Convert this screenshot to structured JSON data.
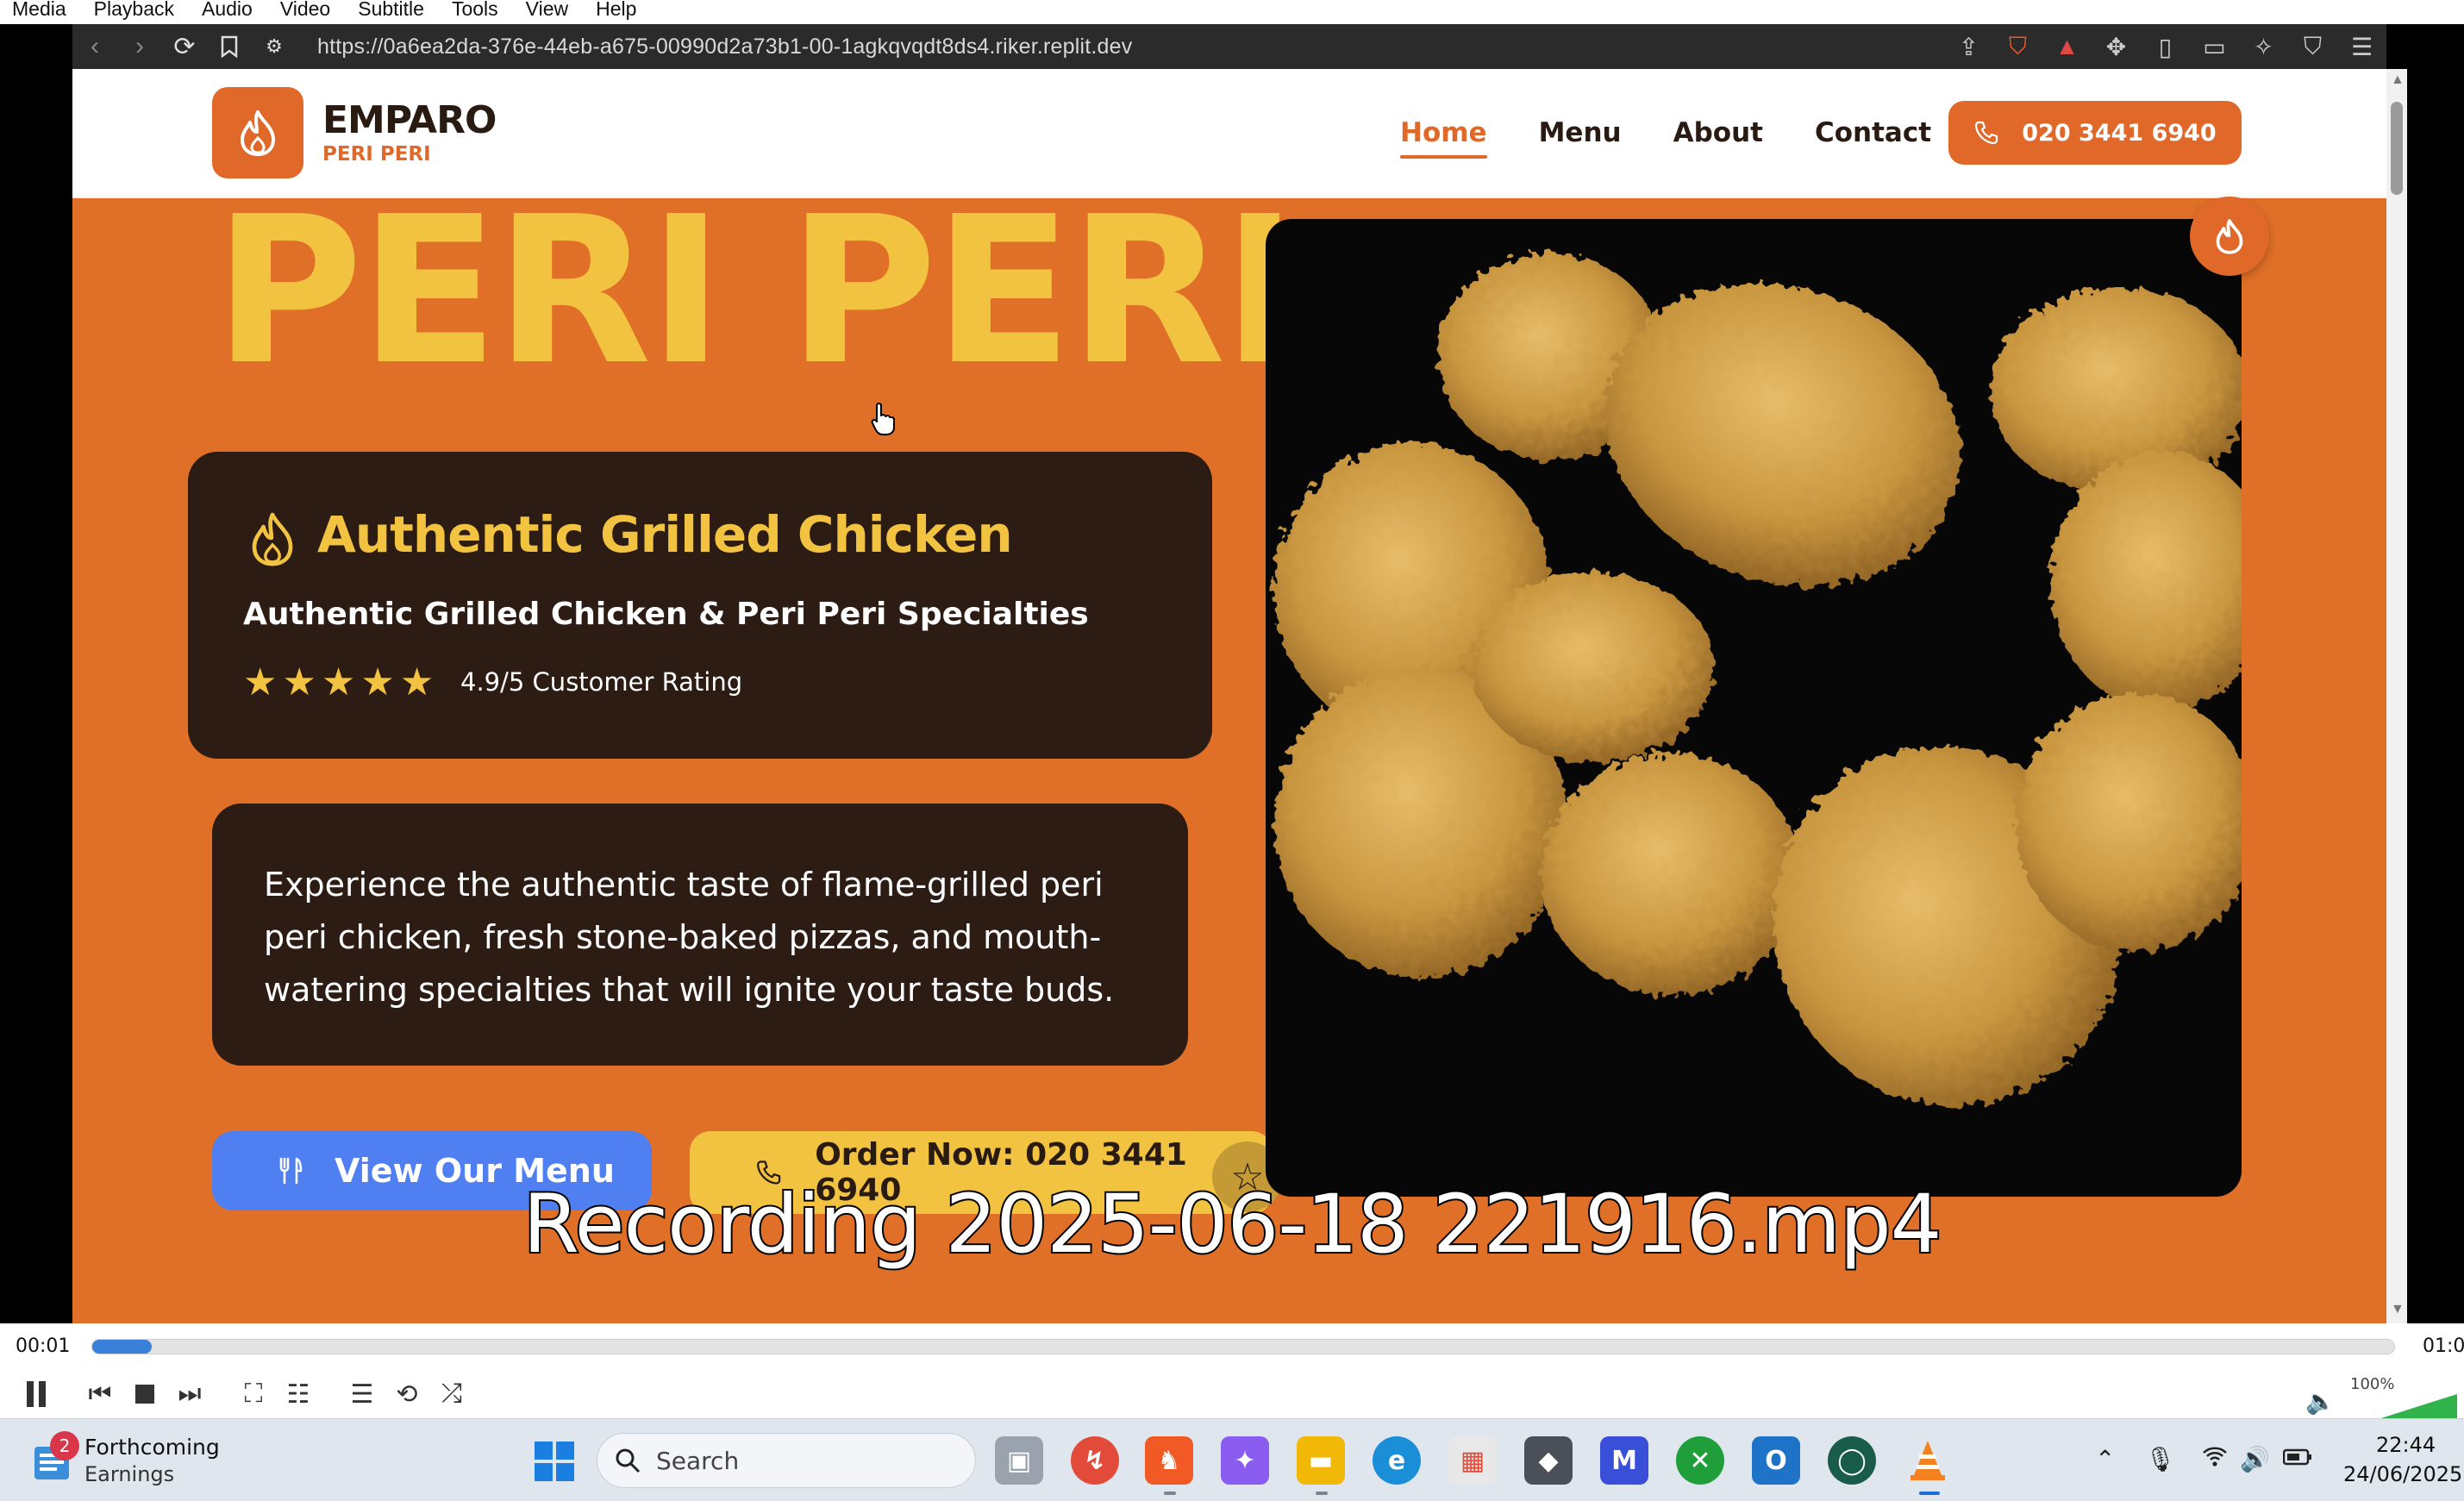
{
  "vlc": {
    "menu": [
      "Media",
      "Playback",
      "Audio",
      "Video",
      "Subtitle",
      "Tools",
      "View",
      "Help"
    ],
    "subtitle_text": "Recording 2025-06-18 221916.mp4",
    "time_current": "00:01",
    "time_total": "01:0",
    "seek_progress_percent": 2.6,
    "volume_label": "100%"
  },
  "browser": {
    "url": "https://0a6ea2da-376e-44eb-a675-00990d2a73b1-00-1agkqvqdt8ds4.riker.replit.dev"
  },
  "site": {
    "logo_name": "EMPARO",
    "logo_sub": "PERI PERI",
    "nav": {
      "home": "Home",
      "menu": "Menu",
      "about": "About",
      "contact": "Contact"
    },
    "phone_button": "020 3441 6940",
    "hero_title": "PERI PERI",
    "card_title": "Authentic Grilled Chicken",
    "card_subtitle": "Authentic Grilled Chicken & Peri Peri Specialties",
    "rating_stars": 5,
    "rating_text": "4.9/5 Customer Rating",
    "description": "Experience the authentic taste of flame-grilled peri peri chicken, fresh stone-baked pizzas, and mouth-watering specialties that will ignite your taste buds.",
    "btn_view_menu": "View Our Menu",
    "btn_order": "Order Now: 020 3441 6940"
  },
  "taskbar": {
    "widget_badge": "2",
    "widget_title": "Forthcoming",
    "widget_subtitle": "Earnings",
    "search_placeholder": "Search",
    "time": "22:44",
    "date": "24/06/2025"
  },
  "colors": {
    "brand_orange": "#e0692a",
    "hero_yellow": "#f2c341",
    "card_dark": "#2c1c14",
    "menu_button_blue": "#4f7ff0"
  }
}
